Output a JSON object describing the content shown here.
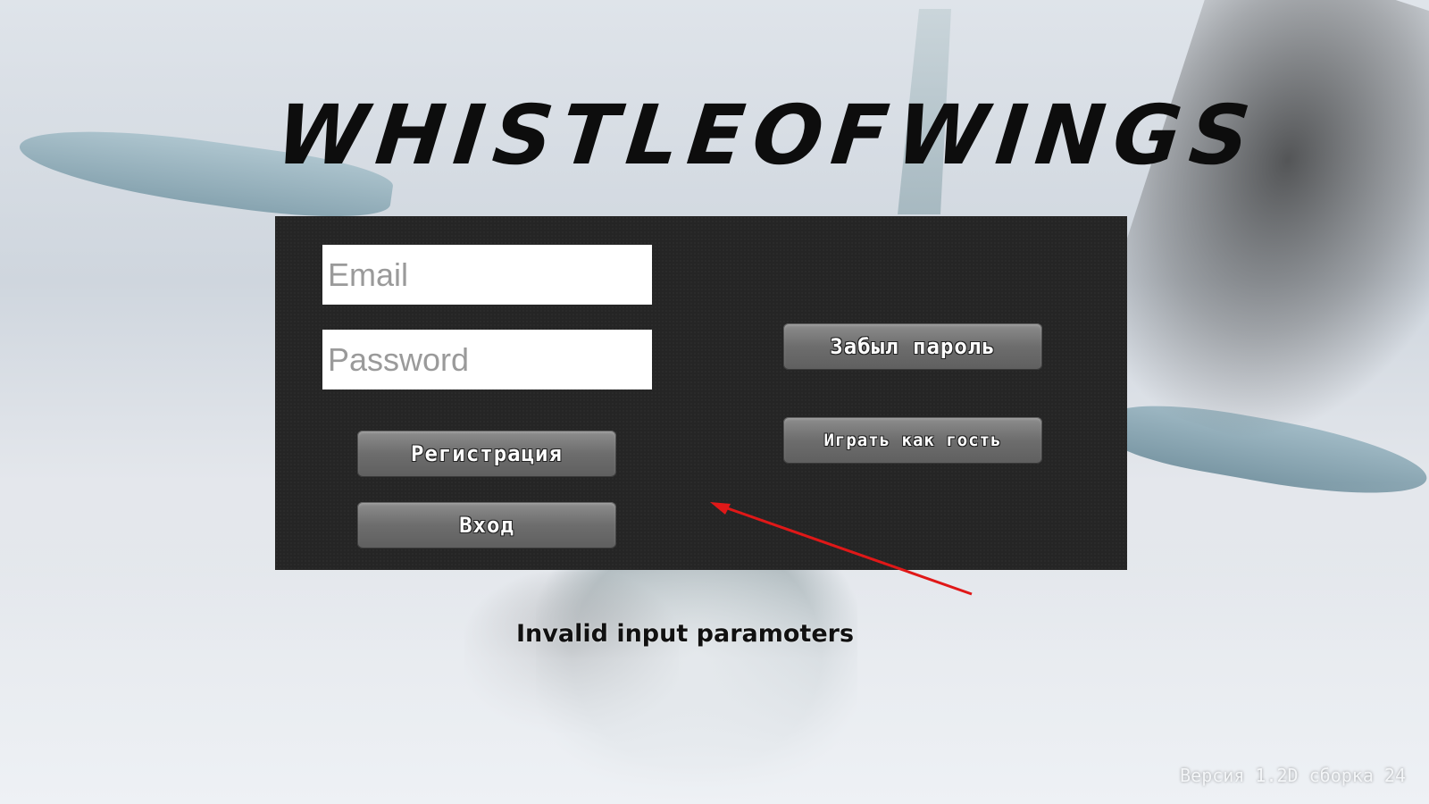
{
  "title": {
    "words": [
      "WHISTLE",
      "OF",
      "WINGS"
    ]
  },
  "login": {
    "email_placeholder": "Email",
    "email_value": "",
    "password_placeholder": "Password",
    "password_value": "",
    "register_label": "Регистрация",
    "login_label": "Вход",
    "forgot_label": "Забыл пароль",
    "guest_label": "Играть как гость"
  },
  "status": {
    "error_text": "Invalid input paramoters"
  },
  "footer": {
    "version_text": "Версия 1.2D сборка 24"
  },
  "colors": {
    "panel": "#252525",
    "button": "#6d6d6d",
    "annotation_arrow": "#e01818"
  },
  "icons": {
    "annotation": "arrow-annotation"
  }
}
